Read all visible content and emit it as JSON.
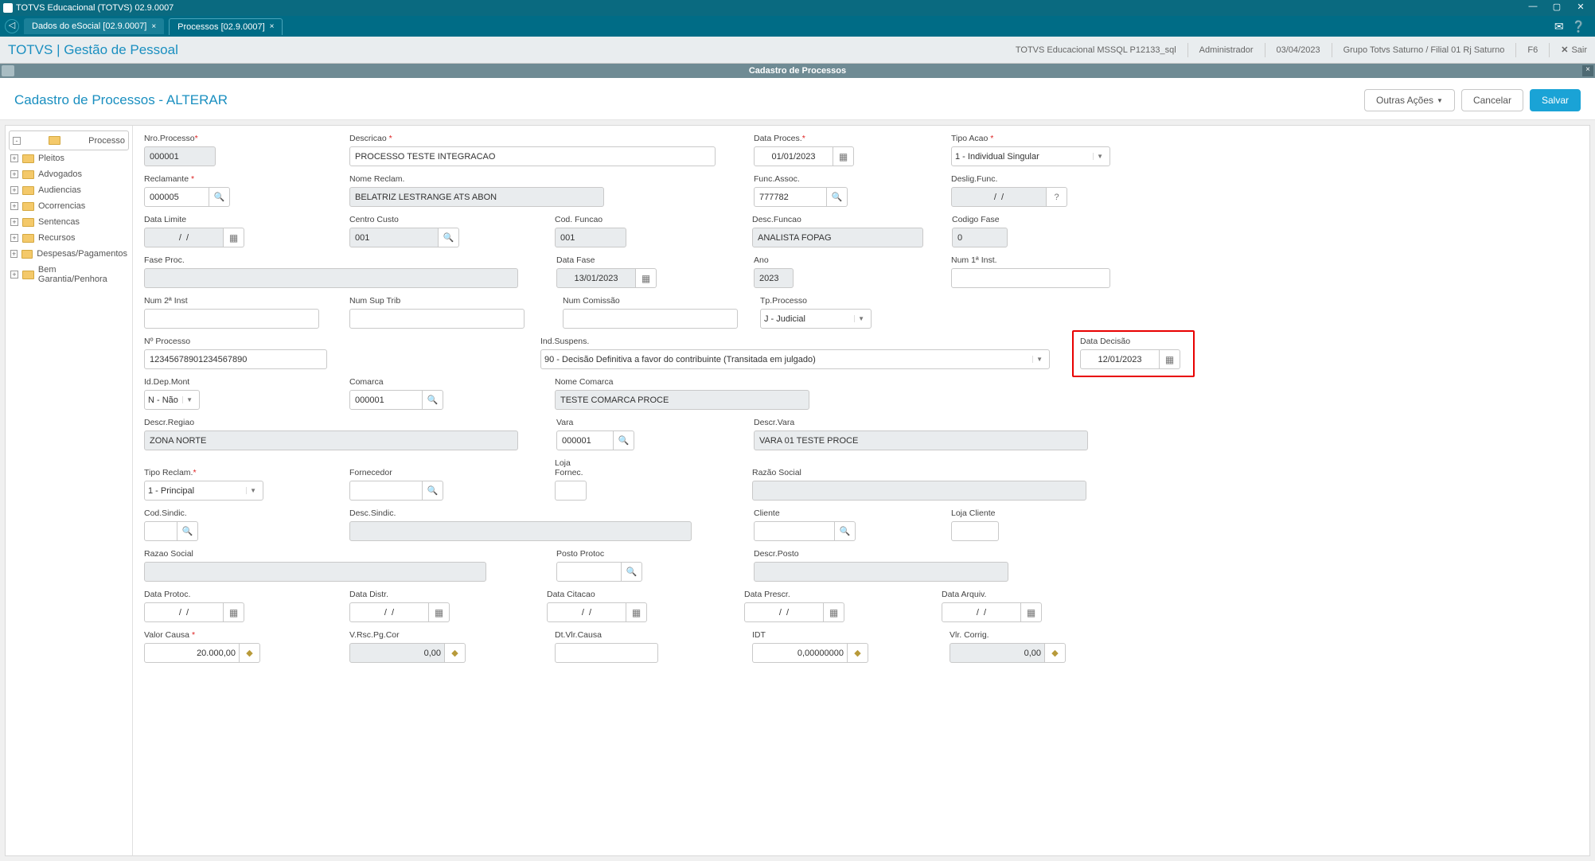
{
  "titlebar": {
    "text": "TOTVS Educacional (TOTVS) 02.9.0007"
  },
  "tabs": {
    "tab1": "Dados do eSocial [02.9.0007]",
    "tab2": "Processos [02.9.0007]"
  },
  "moduleBar": {
    "title": "TOTVS | Gestão de Pessoal",
    "env": "TOTVS Educacional MSSQL P12133_sql",
    "user": "Administrador",
    "date": "03/04/2023",
    "company": "Grupo Totvs Saturno / Filial 01 Rj Saturno",
    "f6": "F6",
    "sair": "Sair"
  },
  "windowHeader": {
    "title": "Cadastro de Processos"
  },
  "pageHeader": {
    "title": "Cadastro de Processos - ALTERAR",
    "outrasAcoes": "Outras Ações",
    "cancelar": "Cancelar",
    "salvar": "Salvar"
  },
  "tree": {
    "items": [
      "Processo",
      "Pleitos",
      "Advogados",
      "Audiencias",
      "Ocorrencias",
      "Sentencas",
      "Recursos",
      "Despesas/Pagamentos",
      "Bem Garantia/Penhora"
    ]
  },
  "form": {
    "nroProcesso": {
      "label": "Nro.Processo",
      "value": "000001"
    },
    "descricao": {
      "label": "Descricao",
      "value": "PROCESSO TESTE INTEGRACAO"
    },
    "dataProces": {
      "label": "Data Proces.",
      "value": "01/01/2023"
    },
    "tipoAcao": {
      "label": "Tipo Acao",
      "value": "1 - Individual Singular"
    },
    "reclamante": {
      "label": "Reclamante",
      "value": "000005"
    },
    "nomeReclam": {
      "label": "Nome Reclam.",
      "value": "BELATRIZ LESTRANGE ATS ABON"
    },
    "funcAssoc": {
      "label": "Func.Assoc.",
      "value": "777782"
    },
    "desligFunc": {
      "label": "Deslig.Func.",
      "value": "/  /"
    },
    "dataLimite": {
      "label": "Data Limite",
      "value": "/  /"
    },
    "centroCusto": {
      "label": "Centro Custo",
      "value": "001"
    },
    "codFuncao": {
      "label": "Cod. Funcao",
      "value": "001"
    },
    "descFuncao": {
      "label": "Desc.Funcao",
      "value": "ANALISTA FOPAG"
    },
    "codigoFase": {
      "label": "Codigo Fase",
      "value": "0"
    },
    "faseProc": {
      "label": "Fase Proc.",
      "value": ""
    },
    "dataFase": {
      "label": "Data Fase",
      "value": "13/01/2023"
    },
    "ano": {
      "label": "Ano",
      "value": "2023"
    },
    "num1Inst": {
      "label": "Num 1ª Inst.",
      "value": ""
    },
    "num2Inst": {
      "label": "Num 2ª Inst",
      "value": ""
    },
    "numSupTrib": {
      "label": "Num Sup Trib",
      "value": ""
    },
    "numComissao": {
      "label": "Num Comissão",
      "value": ""
    },
    "tpProcesso": {
      "label": "Tp.Processo",
      "value": "J - Judicial"
    },
    "nProcesso": {
      "label": "Nº Processo",
      "value": "12345678901234567890"
    },
    "indSuspens": {
      "label": "Ind.Suspens.",
      "value": "90 - Decisão Definitiva a favor do contribuinte (Transitada em julgado)"
    },
    "dataDecisao": {
      "label": "Data Decisão",
      "value": "12/01/2023"
    },
    "idDepMont": {
      "label": "Id.Dep.Mont",
      "value": "N - Não"
    },
    "comarca": {
      "label": "Comarca",
      "value": "000001"
    },
    "nomeComarca": {
      "label": "Nome Comarca",
      "value": "TESTE COMARCA PROCE"
    },
    "descrRegiao": {
      "label": "Descr.Regiao",
      "value": "ZONA NORTE"
    },
    "vara": {
      "label": "Vara",
      "value": "000001"
    },
    "descrVara": {
      "label": "Descr.Vara",
      "value": "VARA 01 TESTE PROCE"
    },
    "tipoReclam": {
      "label": "Tipo Reclam.",
      "value": "1 - Principal"
    },
    "fornecedor": {
      "label": "Fornecedor",
      "value": ""
    },
    "lojaFornec": {
      "label": "Loja Fornec.",
      "value": ""
    },
    "razaoSocial": {
      "label": "Razão Social",
      "value": ""
    },
    "codSindic": {
      "label": "Cod.Sindic.",
      "value": ""
    },
    "descSindic": {
      "label": "Desc.Sindic.",
      "value": ""
    },
    "cliente": {
      "label": "Cliente",
      "value": ""
    },
    "lojaCliente": {
      "label": "Loja Cliente",
      "value": ""
    },
    "razaoSocial2": {
      "label": "Razao Social",
      "value": ""
    },
    "postoProtoc": {
      "label": "Posto Protoc",
      "value": ""
    },
    "descrPosto": {
      "label": "Descr.Posto",
      "value": ""
    },
    "dataProtoc": {
      "label": "Data Protoc.",
      "value": "/  /"
    },
    "dataDistr": {
      "label": "Data Distr.",
      "value": "/  /"
    },
    "dataCitacao": {
      "label": "Data Citacao",
      "value": "/  /"
    },
    "dataPrescr": {
      "label": "Data Prescr.",
      "value": "/  /"
    },
    "dataArquiv": {
      "label": "Data Arquiv.",
      "value": "/  /"
    },
    "valorCausa": {
      "label": "Valor Causa",
      "value": "20.000,00"
    },
    "vRscPgCor": {
      "label": "V.Rsc.Pg.Cor",
      "value": "0,00"
    },
    "dtVlrCausa": {
      "label": "Dt.Vlr.Causa",
      "value": ""
    },
    "idt": {
      "label": "IDT",
      "value": "0,00000000"
    },
    "vlrCorrig": {
      "label": "Vlr. Corrig.",
      "value": "0,00"
    }
  }
}
